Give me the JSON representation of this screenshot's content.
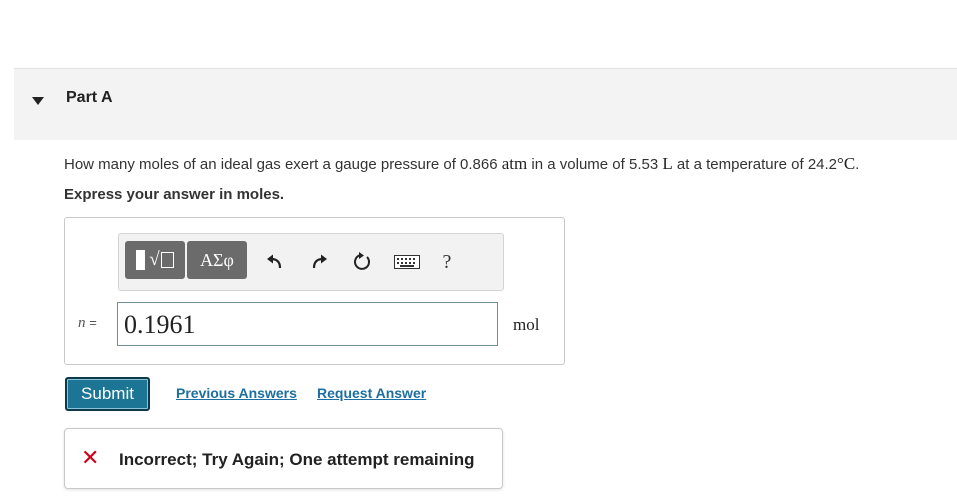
{
  "part": {
    "title": "Part A"
  },
  "question": {
    "prefix": "How many moles of an ideal gas exert a gauge pressure of 0.866 ",
    "pressure_unit": "atm",
    "mid1": " in a volume of 5.53 ",
    "volume_unit": "L",
    "mid2": " at a temperature of 24.2",
    "temp_unit": "°C",
    "suffix": "."
  },
  "instruction": "Express your answer in moles.",
  "toolbar": {
    "templates_icon": "templates-icon",
    "greek_label": "ΑΣφ",
    "undo_icon": "undo-icon",
    "redo_icon": "redo-icon",
    "reset_icon": "reset-icon",
    "keyboard_icon": "keyboard-icon",
    "help_label": "?"
  },
  "answer": {
    "variable": "n",
    "equals": "=",
    "value": "0.1961",
    "unit": "mol"
  },
  "actions": {
    "submit_label": "Submit",
    "previous_answers_label": "Previous Answers",
    "request_answer_label": "Request Answer"
  },
  "feedback": {
    "icon": "x-icon",
    "text": "Incorrect; Try Again; One attempt remaining",
    "color": "#d0021b"
  },
  "colors": {
    "submit_bg": "#1c7595",
    "link": "#1c6fa0"
  }
}
